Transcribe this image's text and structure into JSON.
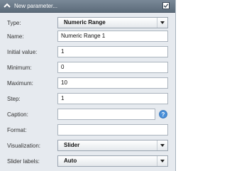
{
  "header": {
    "title": "New parameter..."
  },
  "fields": {
    "type": {
      "label": "Type:",
      "value": "Numeric Range"
    },
    "name": {
      "label": "Name:",
      "value": "Numeric Range 1"
    },
    "initial": {
      "label": "Initial value:",
      "value": "1"
    },
    "minimum": {
      "label": "Minimum:",
      "value": "0"
    },
    "maximum": {
      "label": "Maximum:",
      "value": "10"
    },
    "step": {
      "label": "Step:",
      "value": "1"
    },
    "caption": {
      "label": "Caption:",
      "value": ""
    },
    "format": {
      "label": "Format:",
      "value": ""
    },
    "visualization": {
      "label": "Visualization:",
      "value": "Slider"
    },
    "slider_labels": {
      "label": "Slider labels:",
      "value": "Auto"
    }
  },
  "colors": {
    "header": "#6b7a89",
    "panel": "#e6eaef",
    "help": "#4a90d9"
  },
  "icons": {
    "collapse": "chevron-up-icon",
    "confirm": "checkmark-icon",
    "dropdown": "triangle-down-icon",
    "help": "help-icon"
  }
}
